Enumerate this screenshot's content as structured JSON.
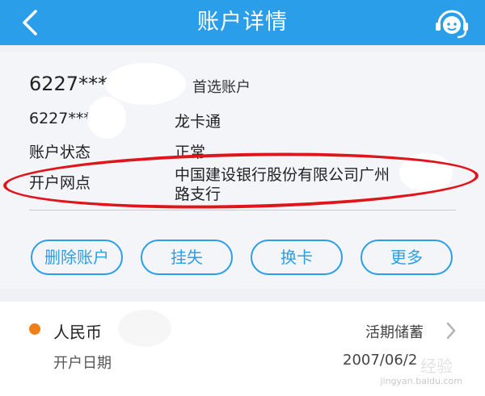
{
  "header": {
    "title": "账户详情",
    "bg_color": "#2a9ee8"
  },
  "account": {
    "card_number_main": "6227***",
    "preferred_label": "首选账户",
    "card_number_sub": "6227***",
    "card_type": "龙卡通",
    "status_label": "账户状态",
    "status_value": "正常",
    "branch_label": "开户网点",
    "branch_value_line1": "中国建设银行股份有限公司广州",
    "branch_value_line2": "路支行"
  },
  "actions": {
    "delete_label": "删除账户",
    "report_loss_label": "挂失",
    "change_card_label": "换卡",
    "more_label": "更多"
  },
  "sub_account": {
    "currency": "人民币",
    "deposit_type": "活期储蓄",
    "open_date_label": "开户日期",
    "open_date_value": "2007/06/2",
    "dot_color": "#f07f1a"
  },
  "watermark": {
    "site": "jingyan.baidu.com",
    "brand": "经验"
  },
  "annotation_color": "#e0151c"
}
